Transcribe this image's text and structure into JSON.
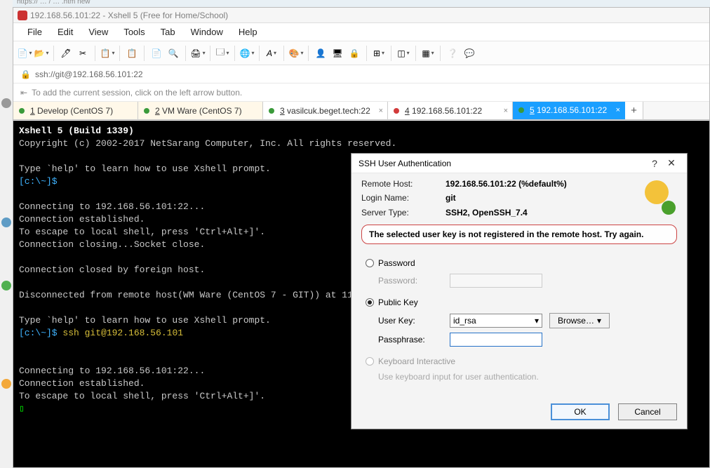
{
  "browser_url": "https:// … / … .htm new",
  "window_title": "192.168.56.101:22 - Xshell 5 (Free for Home/School)",
  "menu": {
    "file": "File",
    "edit": "Edit",
    "view": "View",
    "tools": "Tools",
    "tab": "Tab",
    "window": "Window",
    "help": "Help"
  },
  "address_bar": "ssh://git@192.168.56.101:22",
  "hint_text": "To add the current session, click on the left arrow button.",
  "tabs": [
    {
      "label": "1 Develop (CentOS 7)",
      "underline": "1",
      "dot": "#3a9a3a"
    },
    {
      "label": "2 VM Ware (CentOS 7)",
      "underline": "2",
      "dot": "#3a9a3a"
    },
    {
      "label": "3 vasilcuk.beget.tech:22",
      "underline": "3",
      "dot": "#3a9a3a"
    },
    {
      "label": "4 192.168.56.101:22",
      "underline": "4",
      "dot": "#d23b3b"
    },
    {
      "label": "5 192.168.56.101:22",
      "underline": "5",
      "dot": "#3a9a3a",
      "active": true
    }
  ],
  "terminal": {
    "l1": "Xshell 5 (Build 1339)",
    "l2": "Copyright (c) 2002-2017 NetSarang Computer, Inc. All rights reserved.",
    "l3": "Type `help' to learn how to use Xshell prompt.",
    "prompt": "[c:\\~]$",
    "l5": "Connecting to 192.168.56.101:22...",
    "l6": "Connection established.",
    "l7": "To escape to local shell, press 'Ctrl+Alt+]'.",
    "l8": "Connection closing...Socket close.",
    "l9": "Connection closed by foreign host.",
    "l10": "Disconnected from remote host(WM Ware (CentOS 7 - GIT)) at 11:41",
    "l11": "Type `help' to learn how to use Xshell prompt.",
    "cmd": "ssh git@192.168.56.101",
    "l13": "Connecting to 192.168.56.101:22...",
    "l14": "Connection established.",
    "l15": "To escape to local shell, press 'Ctrl+Alt+]'.",
    "cursor": "▯"
  },
  "dialog": {
    "title": "SSH User Authentication",
    "remote_host_lbl": "Remote Host:",
    "remote_host_val": "192.168.56.101:22 (%default%)",
    "login_lbl": "Login Name:",
    "login_val": "git",
    "server_type_lbl": "Server Type:",
    "server_type_val": "SSH2, OpenSSH_7.4",
    "warning": "The selected user key is not registered in the remote host. Try again.",
    "opt_password": "Password",
    "password_lbl": "Password:",
    "opt_pubkey": "Public Key",
    "user_key_lbl": "User Key:",
    "user_key_val": "id_rsa",
    "browse": "Browse…",
    "passphrase_lbl": "Passphrase:",
    "passphrase_val": "",
    "opt_ki": "Keyboard Interactive",
    "ki_sub": "Use keyboard input for user authentication.",
    "ok": "OK",
    "cancel": "Cancel",
    "help_glyph": "?",
    "close_glyph": "✕"
  }
}
